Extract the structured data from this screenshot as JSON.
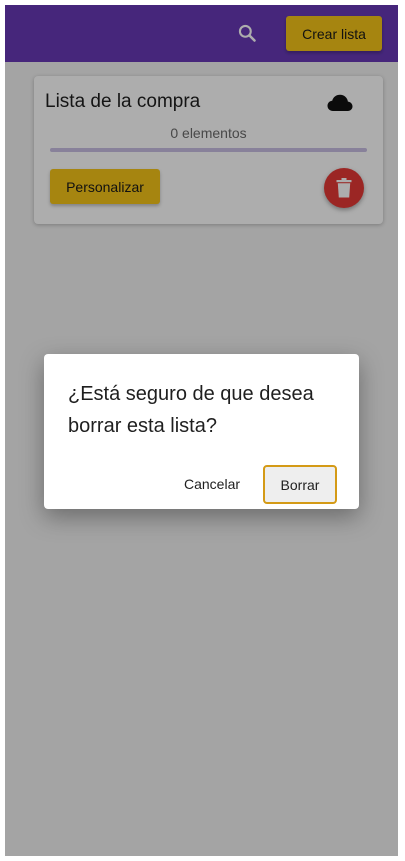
{
  "appbar": {
    "search_icon": "search-icon",
    "create_label": "Crear lista",
    "color": "#6739b6"
  },
  "list_card": {
    "title": "Lista de la compra",
    "sync_icon": "cloud-icon",
    "item_count": "0 elementos",
    "progress_fraction": 0,
    "customize_label": "Personalizar",
    "delete_icon": "trash-icon"
  },
  "dialog": {
    "message": "¿Está seguro de que desea borrar esta lista?",
    "cancel_label": "Cancelar",
    "confirm_label": "Borrar"
  },
  "colors": {
    "accent": "#f5c518",
    "danger": "#e53935",
    "focus_outline": "#d49a16"
  }
}
